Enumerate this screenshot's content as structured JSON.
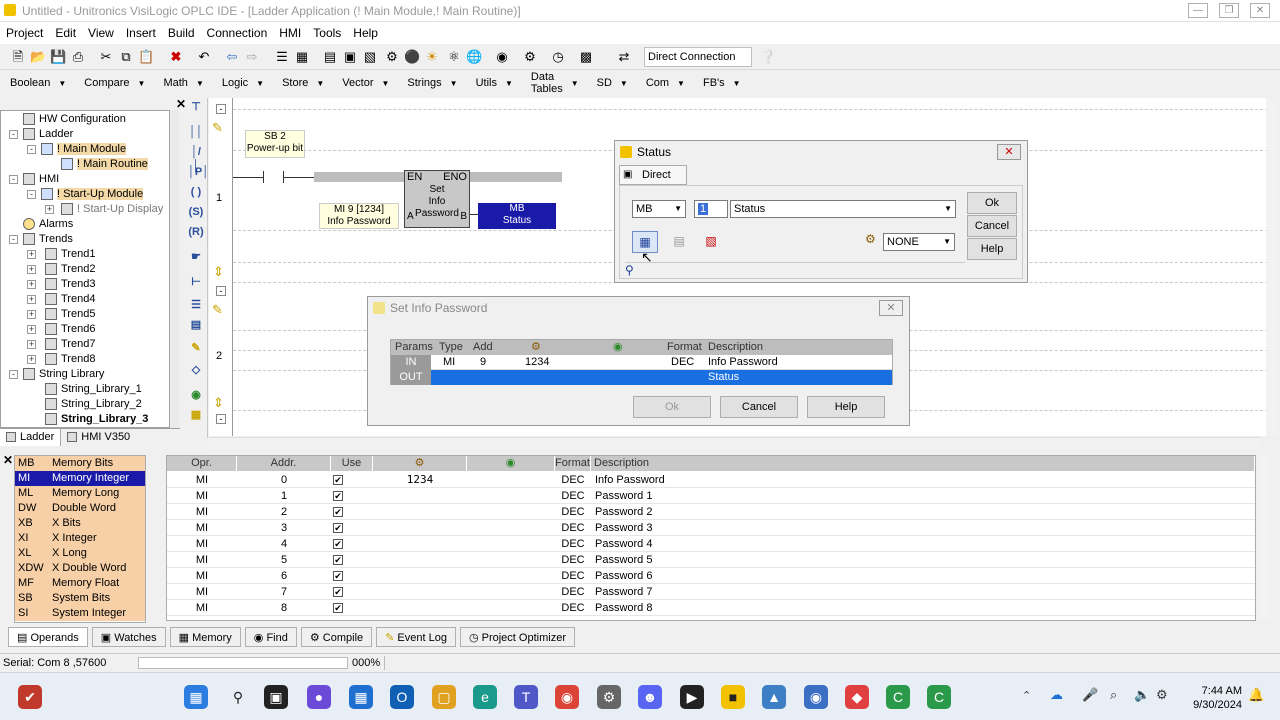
{
  "window": {
    "title": "Untitled - Unitronics VisiLogic OPLC IDE - [Ladder Application (! Main Module,! Main Routine)]"
  },
  "menu": [
    "Project",
    "Edit",
    "View",
    "Insert",
    "Build",
    "Connection",
    "HMI",
    "Tools",
    "Help"
  ],
  "toolbar": {
    "connection": "Direct Connection"
  },
  "ladder_toolbar": [
    "Boolean",
    "Compare",
    "Math",
    "Logic",
    "Store",
    "Vector",
    "Strings",
    "Utils",
    "Data Tables",
    "SD",
    "Com",
    "FB's"
  ],
  "tree": {
    "items": [
      "HW Configuration",
      "Ladder",
      "! Main Module",
      "! Main Routine",
      "HMI",
      "! Start-Up Module",
      "! Start-Up Display",
      "Alarms",
      "Trends",
      "Trend1",
      "Trend2",
      "Trend3",
      "Trend4",
      "Trend5",
      "Trend6",
      "Trend7",
      "Trend8",
      "String Library",
      "String_Library_1",
      "String_Library_2",
      "String_Library_3"
    ],
    "tabs": [
      "Ladder",
      "HMI V350"
    ]
  },
  "ladder": {
    "rung1": "1",
    "rung2": "2",
    "contact_label": "SB 2",
    "contact_desc": "Power-up bit",
    "fb_en": "EN",
    "fb_eno": "ENO",
    "fb_name": "Set\nInfo\nPassword",
    "fb_a": "A",
    "fb_b": "B",
    "input_label": "MI 9 [1234]",
    "input_desc": "Info Password",
    "output_label": "MB",
    "output_desc": "Status"
  },
  "status_dialog": {
    "title": "Status",
    "tab": "Direct",
    "type": "MB",
    "address": "1",
    "description": "Status",
    "none": "NONE",
    "ok": "Ok",
    "cancel": "Cancel",
    "help": "Help"
  },
  "sip_dialog": {
    "title": "Set Info Password",
    "headers": [
      "Params",
      "Type",
      "Add",
      "",
      "",
      "Format",
      "Description"
    ],
    "rows": [
      {
        "param": "IN",
        "type": "MI",
        "add": "9",
        "value": "1234",
        "format": "DEC",
        "desc": "Info Password"
      },
      {
        "param": "OUT",
        "type": "",
        "add": "",
        "value": "",
        "format": "",
        "desc": "Status"
      }
    ],
    "ok": "Ok",
    "cancel": "Cancel",
    "help": "Help"
  },
  "operands": [
    {
      "code": "MB",
      "name": "Memory Bits"
    },
    {
      "code": "MI",
      "name": "Memory Integer"
    },
    {
      "code": "ML",
      "name": "Memory Long"
    },
    {
      "code": "DW",
      "name": "Double Word"
    },
    {
      "code": "XB",
      "name": "X Bits"
    },
    {
      "code": "XI",
      "name": "X Integer"
    },
    {
      "code": "XL",
      "name": "X Long"
    },
    {
      "code": "XDW",
      "name": "X Double Word"
    },
    {
      "code": "MF",
      "name": "Memory Float"
    },
    {
      "code": "SB",
      "name": "System Bits"
    },
    {
      "code": "SI",
      "name": "System Integer"
    }
  ],
  "grid": {
    "headers": [
      "Opr.",
      "Addr.",
      "Use",
      "",
      "",
      "Format",
      "Description"
    ],
    "rows": [
      {
        "opr": "MI",
        "addr": "0",
        "val": "1234",
        "fmt": "DEC",
        "desc": "Info Password"
      },
      {
        "opr": "MI",
        "addr": "1",
        "val": "",
        "fmt": "DEC",
        "desc": "Password 1"
      },
      {
        "opr": "MI",
        "addr": "2",
        "val": "",
        "fmt": "DEC",
        "desc": "Password 2"
      },
      {
        "opr": "MI",
        "addr": "3",
        "val": "",
        "fmt": "DEC",
        "desc": "Password 3"
      },
      {
        "opr": "MI",
        "addr": "4",
        "val": "",
        "fmt": "DEC",
        "desc": "Password 4"
      },
      {
        "opr": "MI",
        "addr": "5",
        "val": "",
        "fmt": "DEC",
        "desc": "Password 5"
      },
      {
        "opr": "MI",
        "addr": "6",
        "val": "",
        "fmt": "DEC",
        "desc": "Password 6"
      },
      {
        "opr": "MI",
        "addr": "7",
        "val": "",
        "fmt": "DEC",
        "desc": "Password 7"
      },
      {
        "opr": "MI",
        "addr": "8",
        "val": "",
        "fmt": "DEC",
        "desc": "Password 8"
      }
    ]
  },
  "bottom_tabs": [
    "Operands",
    "Watches",
    "Memory",
    "Find",
    "Compile",
    "Event Log",
    "Project Optimizer"
  ],
  "status": {
    "serial": "Serial:  Com 8 ,57600",
    "zoom": "000%"
  },
  "taskbar": {
    "time": "7:44 AM",
    "date": "9/30/2024"
  }
}
